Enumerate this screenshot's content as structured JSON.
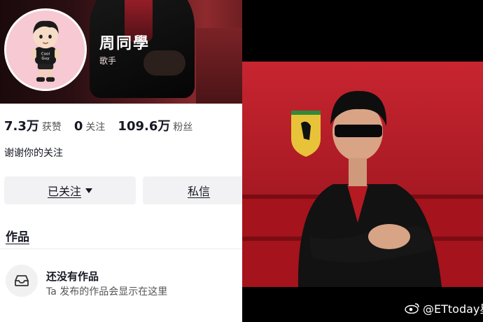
{
  "profile": {
    "name": "周同學",
    "role": "歌手",
    "stats": [
      {
        "value": "7.3万",
        "label": "获赞"
      },
      {
        "value": "0",
        "label": "关注"
      },
      {
        "value": "109.6万",
        "label": "粉丝"
      }
    ],
    "bio": "谢谢你的关注",
    "follow_button": "已关注",
    "message_button": "私信",
    "works_tab": "作品",
    "empty_title": "还没有作品",
    "empty_subtitle": "Ta 发布的作品会显示在这里",
    "avatar_text": "Cool Guy"
  },
  "watermark": {
    "text": "@ETtoday星光雲官方微博"
  },
  "colors": {
    "text_primary": "#161823",
    "button_bg": "#f2f2f4",
    "avatar_bg": "#f6c9d3",
    "photo_red": "#b81b24"
  },
  "icons": [
    "caret-down-icon",
    "inbox-icon",
    "weibo-icon"
  ]
}
